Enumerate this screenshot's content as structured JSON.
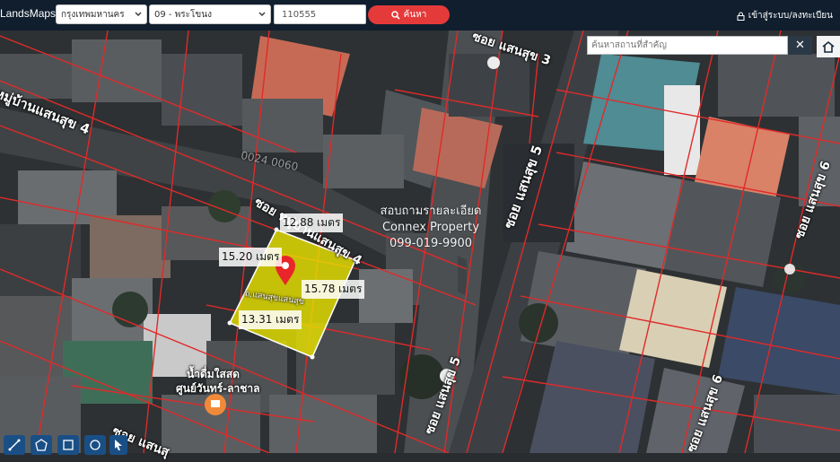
{
  "header": {
    "brand": "LandsMaps",
    "province_select": "กรุงเทพมหานคร",
    "district_select": "09 - พระโขนง",
    "deed_number_value": "110555",
    "search_label": "ค้นหา",
    "login_label": "เข้าสู่ระบบ/ลงทะเบียน"
  },
  "map": {
    "landmark_search_placeholder": "ค้นหาสถานที่สำคัญ",
    "clear_symbol": "✕",
    "plot_label": "ถ.แสนสุขแสนสุข",
    "measurements": {
      "top": "12.88 เมตร",
      "left": "15.20 เมตร",
      "right": "15.78 เมตร",
      "bottom": "13.31 เมตร"
    },
    "streets": {
      "soi3": "ซอย แสนสุข 3",
      "village4": "หมู่บ้านแสนสุข 4",
      "soi4_upper": "ซอย หมู่บ้านแสนสุข 4",
      "soi5_upper": "ซอย แสนสุข 5",
      "soi5_lower": "ซอย แสนสุข 5",
      "soi6_right": "ซอย แสนสุข 6",
      "soi6_bottom": "ซอย แสนสุข 6",
      "soi_bottom_left": "ซอย แสนสุ"
    },
    "poi_label_line1": "น้ำดื่มใสสด",
    "poi_label_line2": "ศูนย์วันทร์-ลาชาล",
    "watermark": {
      "line1": "สอบถามรายละเอียด",
      "line2": "Connex Property",
      "line3": "099-019-9900"
    },
    "blurred_deed_text": "0024 0060"
  },
  "colors": {
    "topbar": "#101e2e",
    "search_button": "#e53a3a",
    "parcel_lines": "#e02a2a",
    "plot_fill": "#e6e200",
    "pin": "#e8262a",
    "tool_buttons": "#1a4f86"
  },
  "icons": {
    "chevron": "chevron-down-icon",
    "search": "search-icon",
    "lock": "lock-icon",
    "home": "home-icon",
    "pin": "map-pin-icon",
    "poi": "restaurant-icon"
  },
  "tools": [
    "draw-line-tool",
    "polygon-tool",
    "rectangle-tool",
    "circle-tool",
    "cursor-tool"
  ]
}
